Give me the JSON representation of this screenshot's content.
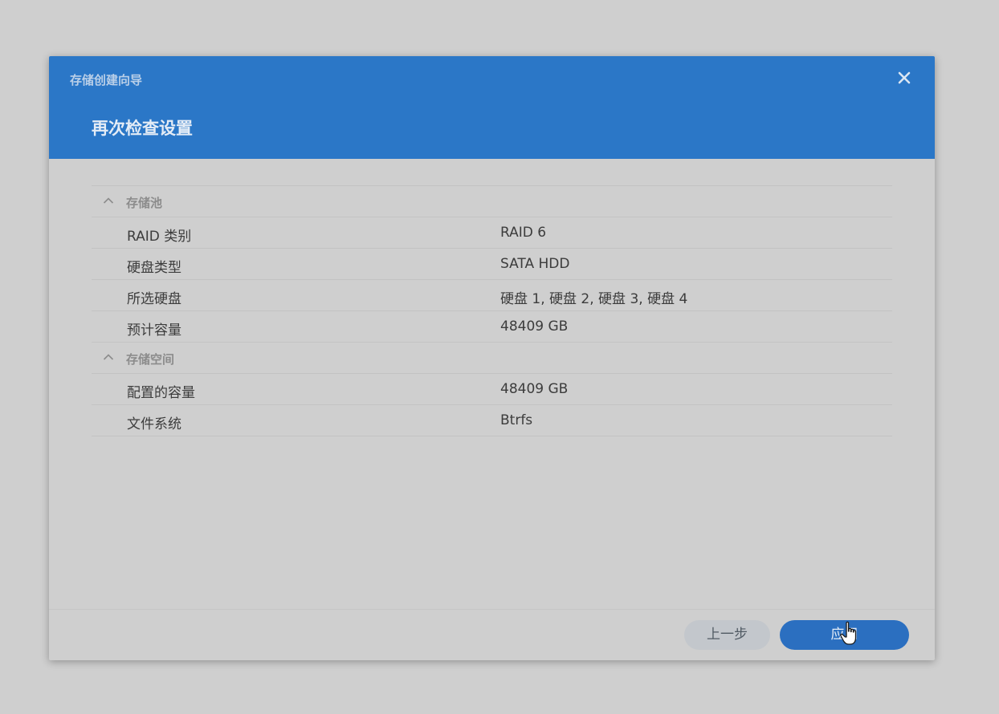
{
  "window": {
    "wizard_title": "存储创建向导",
    "step_title": "再次检查设置",
    "close_icon": "close-icon"
  },
  "sections": [
    {
      "title": "存储池",
      "icon": "chevron-up-icon",
      "rows": [
        {
          "label": "RAID 类别",
          "value": "RAID 6"
        },
        {
          "label": "硬盘类型",
          "value": "SATA HDD"
        },
        {
          "label": "所选硬盘",
          "value": "硬盘 1, 硬盘 2, 硬盘 3, 硬盘 4"
        },
        {
          "label": "预计容量",
          "value": "48409 GB"
        }
      ]
    },
    {
      "title": "存储空间",
      "icon": "chevron-up-icon",
      "rows": [
        {
          "label": "配置的容量",
          "value": "48409 GB"
        },
        {
          "label": "文件系统",
          "value": "Btrfs"
        }
      ]
    }
  ],
  "footer": {
    "back_label": "上一步",
    "apply_label": "应用"
  },
  "colors": {
    "header": "#2b77c7",
    "apply_button": "#2b6fc0",
    "back_button": "#c3c7cc",
    "background": "#cfcfcf"
  }
}
